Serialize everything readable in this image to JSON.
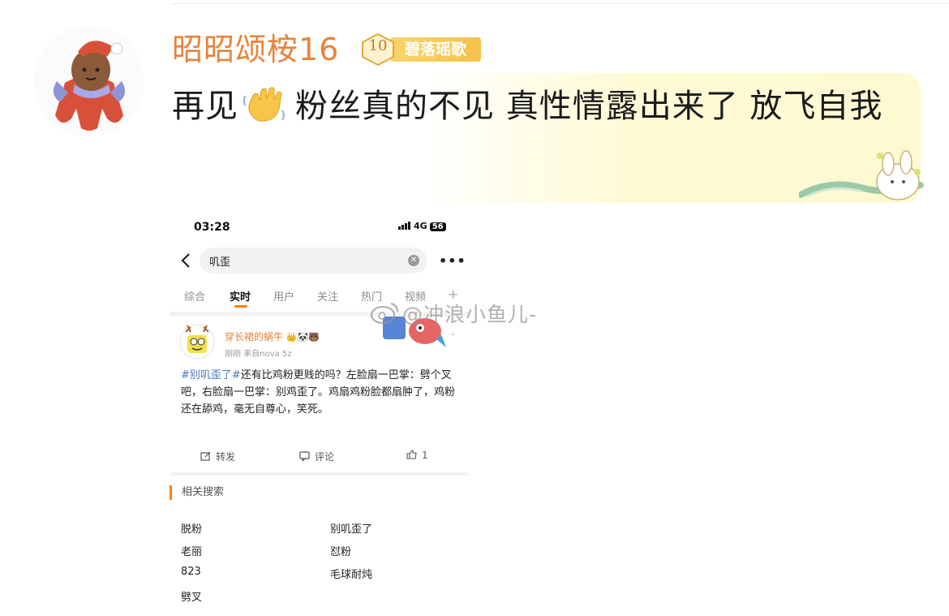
{
  "post": {
    "username": "昭昭颂桉16",
    "badge_level": "10",
    "badge_name": "碧落瑶歌",
    "text_before_emoji": "再见",
    "emoji": "waving-hand-icon",
    "text_after_emoji": "粉丝真的不见 真性情露出来了 放飞自我"
  },
  "screenshot": {
    "status": {
      "time": "03:28",
      "network": "4G",
      "battery": "56"
    },
    "search": {
      "query": "叽歪"
    },
    "tabs": [
      {
        "label": "综合"
      },
      {
        "label": "实时",
        "active": true
      },
      {
        "label": "用户"
      },
      {
        "label": "关注"
      },
      {
        "label": "热门"
      },
      {
        "label": "视频"
      }
    ],
    "item": {
      "user": "穿长裙的蜗牛",
      "user_emojis": "👑🐼🐻",
      "time": "刚刚",
      "source": "来自nova 5z",
      "hashtag": "#别叽歪了#",
      "body": "还有比鸡粉更贱的吗？左脸扇一巴掌：劈个叉吧，右脸扇一巴掌：别鸡歪了。鸡扇鸡粉脸都扇肿了，鸡粉还在舔鸡，毫无自尊心，笑死。",
      "actions": {
        "repost": "转发",
        "comment": "评论",
        "like": "1"
      }
    },
    "related": {
      "title": "相关搜索",
      "left": [
        "脱粉",
        "老丽",
        "823",
        "劈叉"
      ],
      "right": [
        "别叽歪了",
        "怼粉",
        "毛球耐炖"
      ]
    }
  },
  "watermark": {
    "text": "@冲浪小鱼儿-"
  }
}
